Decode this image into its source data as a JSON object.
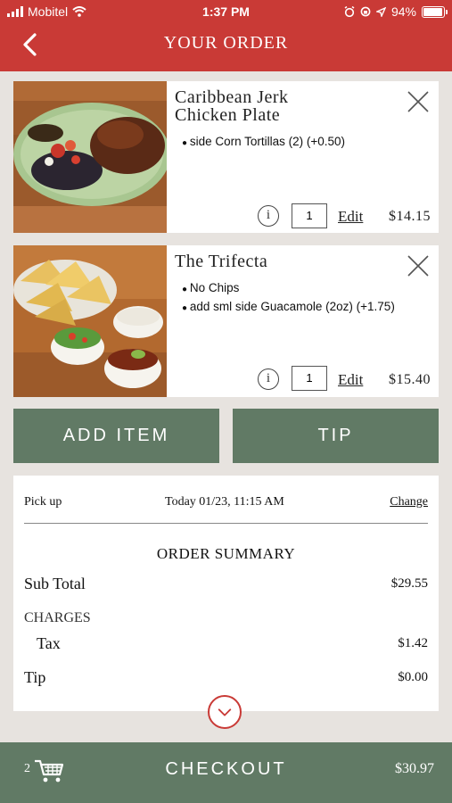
{
  "status_bar": {
    "carrier": "Mobitel",
    "time": "1:37 PM",
    "battery": "94%"
  },
  "header": {
    "title": "YOUR ORDER"
  },
  "items": [
    {
      "name_line1": "Caribbean Jerk",
      "name_line2": "Chicken Plate",
      "modifiers": [
        "side Corn Tortillas (2) (+0.50)"
      ],
      "qty": "1",
      "info_label": "i",
      "edit_label": "Edit",
      "price": "$14.15"
    },
    {
      "name_line1": "The Trifecta",
      "name_line2": "",
      "modifiers": [
        "No Chips",
        "add sml side Guacamole (2oz) (+1.75)"
      ],
      "qty": "1",
      "info_label": "i",
      "edit_label": "Edit",
      "price": "$15.40"
    }
  ],
  "actions": {
    "add_item": "ADD ITEM",
    "tip": "TIP"
  },
  "pickup": {
    "label": "Pick up",
    "when": "Today 01/23, 11:15 AM",
    "change": "Change"
  },
  "summary": {
    "title": "ORDER SUMMARY",
    "subtotal_label": "Sub Total",
    "subtotal": "$29.55",
    "charges_label": "CHARGES",
    "tax_label": "Tax",
    "tax": "$1.42",
    "tip_label": "Tip",
    "tip": "$0.00"
  },
  "checkout": {
    "count": "2",
    "label": "CHECKOUT",
    "total": "$30.97"
  },
  "colors": {
    "brand_red": "#c93a36",
    "green": "#617a65",
    "background": "#e7e3df"
  }
}
